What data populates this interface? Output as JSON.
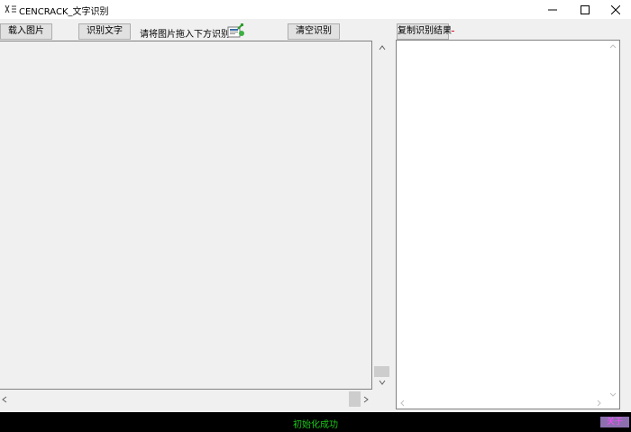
{
  "window": {
    "title": "CENCRACK_文字识别",
    "minimize_glyph": "minimize-icon",
    "maximize_glyph": "maximize-icon",
    "close_glyph": "close-icon"
  },
  "toolbar": {
    "load_image_label": "载入图片",
    "recognize_label": "识别文字",
    "hint_text": "请将图片拖入下方识别!",
    "hint_icon": "drop-image-icon",
    "clear_label": "清空识别",
    "copy_result_label": "复制识别结果"
  },
  "result": {
    "text": ""
  },
  "status": {
    "message": "初始化成功",
    "badge": "关于"
  },
  "colors": {
    "status_bg": "#000000",
    "status_text": "#19c719",
    "badge_bg": "#8d6fb0",
    "badge_text": "#ff4aff"
  }
}
